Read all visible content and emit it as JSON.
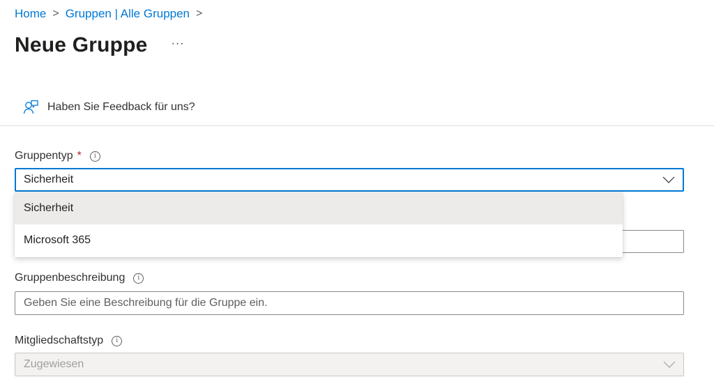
{
  "breadcrumb": {
    "items": [
      "Home",
      "Gruppen | Alle Gruppen"
    ],
    "separator": ">"
  },
  "page": {
    "title": "Neue Gruppe",
    "more": "···"
  },
  "feedback": {
    "icon": "feedback-person-icon",
    "label": "Haben Sie Feedback für uns?"
  },
  "group_type": {
    "label": "Gruppentyp",
    "required_marker": "*",
    "info": "i",
    "value": "Sicherheit",
    "options": [
      "Sicherheit",
      "Microsoft 365"
    ],
    "selected_index": 0
  },
  "group_description": {
    "label": "Gruppenbeschreibung",
    "info": "i",
    "placeholder": "Geben Sie eine Beschreibung für die Gruppe ein."
  },
  "membership_type": {
    "label": "Mitgliedschaftstyp",
    "info": "i",
    "value": "Zugewiesen",
    "disabled": true
  },
  "colors": {
    "accent": "#0078d4",
    "required": "#a4262c",
    "text": "#323130",
    "selected_option_bg": "#edebe9"
  }
}
